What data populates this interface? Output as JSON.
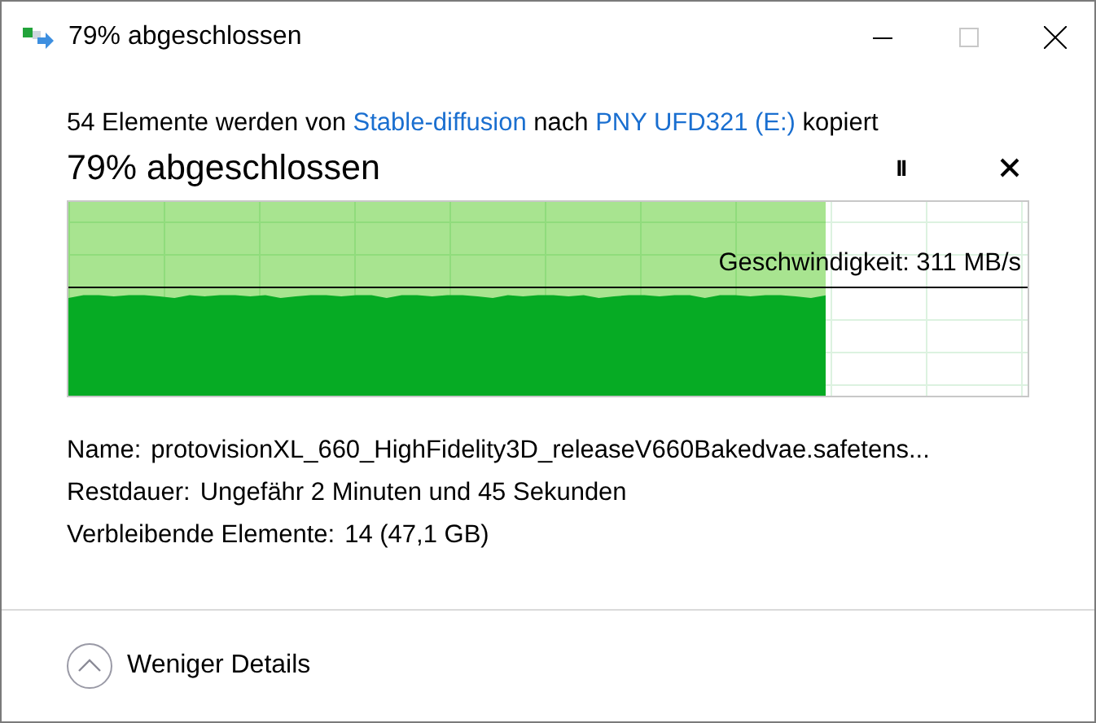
{
  "window": {
    "title": "79% abgeschlossen"
  },
  "description": [
    {
      "kind": "text",
      "text": "54 Elemente werden von "
    },
    {
      "kind": "link",
      "text": "Stable-diffusion"
    },
    {
      "kind": "text",
      "text": " nach "
    },
    {
      "kind": "link",
      "text": "PNY UFD321 (E:)"
    },
    {
      "kind": "text",
      "text": " kopiert"
    }
  ],
  "heading": "79% abgeschlossen",
  "pause_button": {
    "label": "II"
  },
  "progress": {
    "level": 0.79,
    "speed": "Geschwindigkeit: 311 MB/s"
  },
  "details": [
    {
      "label": "Name:",
      "value": "protovisionXL_660_HighFidelity3D_releaseV660Bakedvae.safetens..."
    },
    {
      "label": "Restdauer:",
      "value": "Ungefähr 2 Minuten und 45 Sekunden"
    },
    {
      "label": "Verbleibende Elemente:",
      "value": "14 (47,1 GB)"
    }
  ],
  "toggle": {
    "label": "Weniger Details"
  }
}
